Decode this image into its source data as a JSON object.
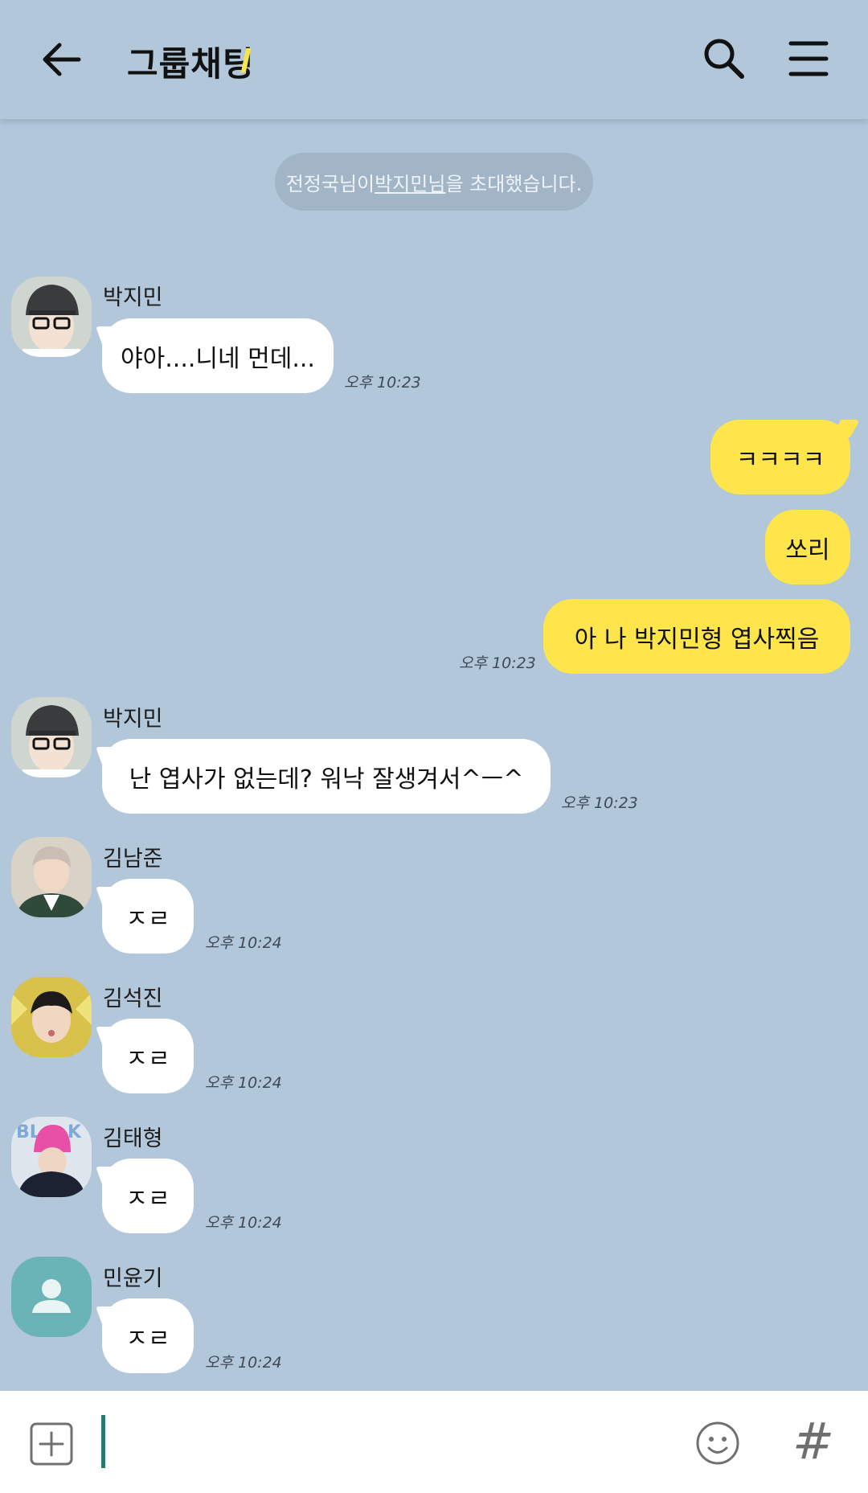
{
  "header": {
    "title": "그룹채팅"
  },
  "notice": {
    "prefix": "전정국님이 ",
    "highlight": "박지민님",
    "suffix": "을 초대했습니다."
  },
  "messages": [
    {
      "sender": "박지민",
      "text": "야아....니네 먼데...",
      "time": "오후 10:23"
    },
    {
      "text": "ㅋㅋㅋㅋ"
    },
    {
      "text": "쏘리"
    },
    {
      "text": "아 나 박지민형 엽사찍음",
      "time": "오후 10:23"
    },
    {
      "sender": "박지민",
      "text": "난 엽사가 없는데? 워낙 잘생겨서^ㅡ^",
      "time": "오후 10:23"
    },
    {
      "sender": "김남준",
      "text": "ㅈㄹ",
      "time": "오후 10:24"
    },
    {
      "sender": "김석진",
      "text": "ㅈㄹ",
      "time": "오후 10:24"
    },
    {
      "sender": "김태형",
      "text": "ㅈㄹ",
      "time": "오후 10:24"
    },
    {
      "sender": "민윤기",
      "text": "ㅈㄹ",
      "time": "오후 10:24"
    }
  ],
  "input": {
    "value": "",
    "placeholder": ""
  },
  "icons": {
    "back": "arrow-left-icon",
    "search": "search-icon",
    "menu": "hamburger-menu-icon",
    "plus": "plus-square-icon",
    "emoji": "smiley-icon",
    "hash": "#"
  },
  "colors": {
    "background": "#b2c7da",
    "my_bubble": "#fde54b",
    "other_bubble": "#ffffff",
    "accent": "#2a7b6f"
  }
}
